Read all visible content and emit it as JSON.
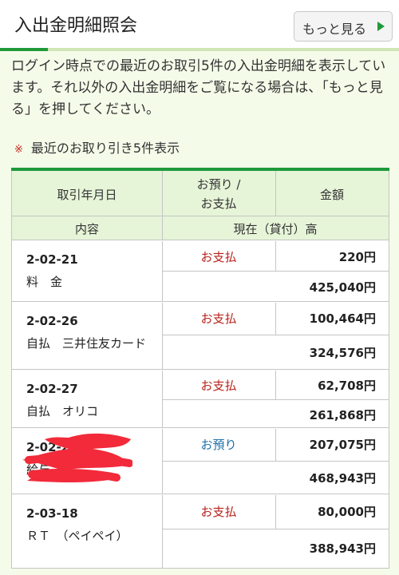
{
  "header": {
    "title": "入出金明細照会",
    "more_button": "もっと見る"
  },
  "intro": {
    "text": "ログイン時点での最近のお取引5件の入出金明細を表示しています。それ以外の入出金明細をご覧になる場合は、「もっと見る」を押してください。"
  },
  "note": {
    "mark": "※",
    "text": "最近のお取り引き5件表示"
  },
  "table": {
    "headers": {
      "date": "取引年月日",
      "type_line1": "お預り /",
      "type_line2": "お支払",
      "amount": "金額",
      "content": "内容",
      "balance": "現在（貸付）高"
    },
    "rows": [
      {
        "date": "2-02-21",
        "desc": "料　金",
        "type": "お支払",
        "type_kind": "pay",
        "amount": "220円",
        "balance": "425,040円"
      },
      {
        "date": "2-02-26",
        "desc": "自払　三井住友カード",
        "type": "お支払",
        "type_kind": "pay",
        "amount": "100,464円",
        "balance": "324,576円"
      },
      {
        "date": "2-02-27",
        "desc": "自払　オリコ",
        "type": "お支払",
        "type_kind": "pay",
        "amount": "62,708円",
        "balance": "261,868円"
      },
      {
        "date": "2-02-28",
        "desc": "給与",
        "type": "お預り",
        "type_kind": "dep",
        "amount": "207,075円",
        "balance": "468,943円"
      },
      {
        "date": "2-03-18",
        "desc": "ＲＴ　（ペイペイ）",
        "type": "お支払",
        "type_kind": "pay",
        "amount": "80,000円",
        "balance": "388,943円"
      }
    ]
  },
  "colors": {
    "accent_green": "#1f9a3a",
    "header_bg": "#e6f4d8",
    "page_bg": "#f5fbe9",
    "pay_red": "#b8221c",
    "deposit_blue": "#1e6fa8"
  }
}
